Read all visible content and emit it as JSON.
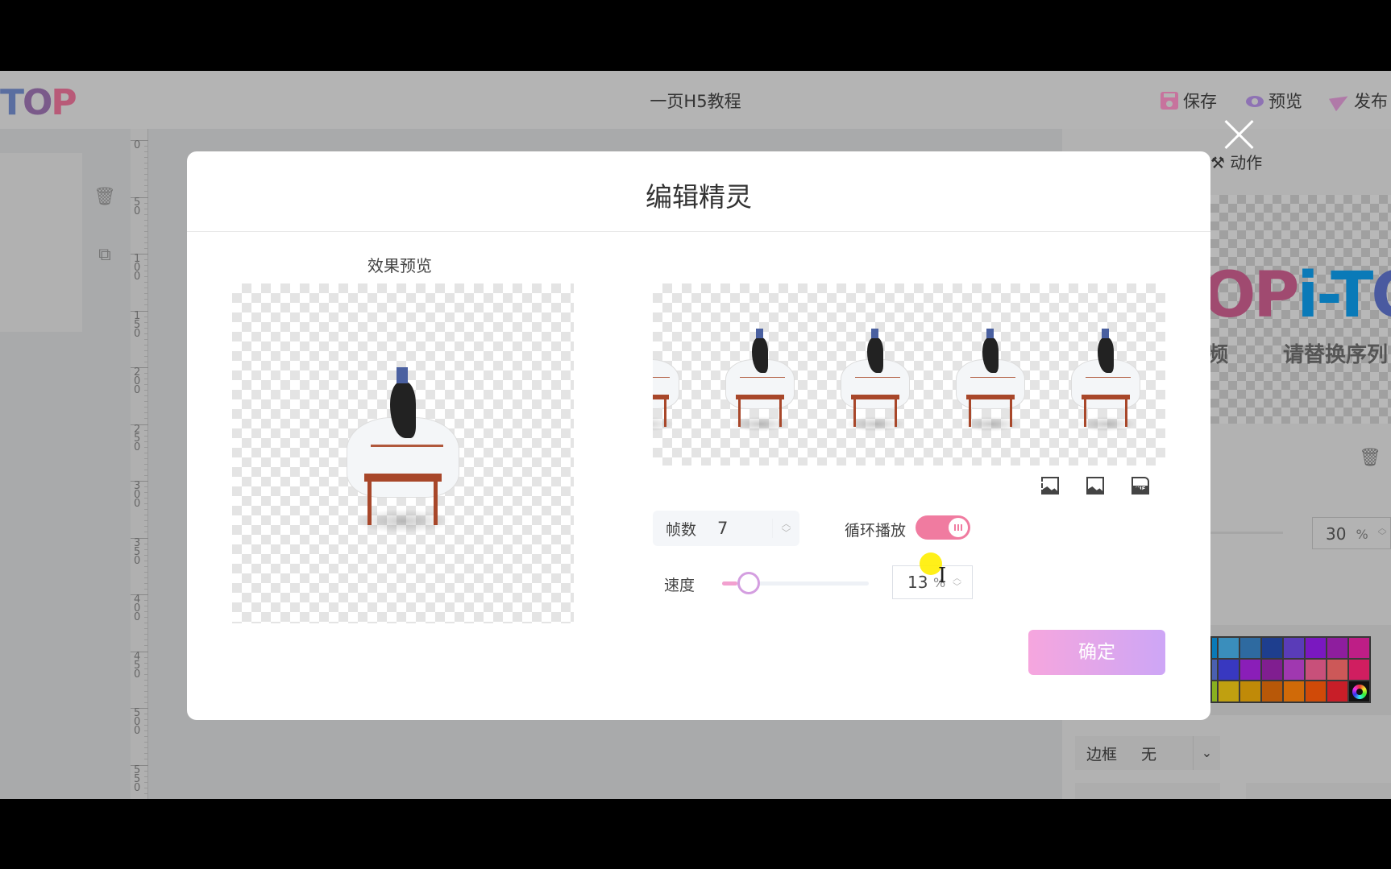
{
  "app": {
    "logo_text": [
      "T",
      "O",
      "P"
    ],
    "title": "一页H5教程",
    "actions": [
      {
        "icon": "save-icon",
        "label": "保存"
      },
      {
        "icon": "eye-icon",
        "label": "预览"
      },
      {
        "icon": "send-icon",
        "label": "发布"
      }
    ]
  },
  "canvas": {
    "left_tools": [
      {
        "icon": "trash-icon",
        "glyph": "🗑"
      },
      {
        "icon": "duplicate-icon",
        "glyph": "⧉"
      }
    ],
    "ruler_ticks": [
      "0",
      "50",
      "100",
      "150",
      "200",
      "250",
      "300",
      "350",
      "400",
      "450",
      "500",
      "550"
    ],
    "timeline": {
      "play_icon": "play-icon"
    }
  },
  "right_panel": {
    "tab_label": "动作",
    "tab_icon_glyph": "⚒",
    "preview_logo": {
      "part1": "OP",
      "part2": "i-T",
      "part3": "O"
    },
    "preview_subtitle_left": "频",
    "preview_subtitle": "请替换序列",
    "trash_glyph": "🗑",
    "opacity": {
      "value": "30",
      "unit": "%"
    },
    "palette": {
      "colors": [
        [
          "#0a7ab8",
          "#3a8ebc",
          "#2e6aa0",
          "#1e3e8e",
          "#5a3cb8",
          "#7a18c0",
          "#8e1e9e",
          "#be1e86"
        ],
        [
          "#4a60b0",
          "#3838c0",
          "#8a1eb8",
          "#801e90",
          "#a038b0",
          "#c8507a",
          "#cc5858",
          "#d01e60"
        ],
        [
          "#88b020",
          "#c0a010",
          "#c08a08",
          "#b85808",
          "#d06a08",
          "#d04a08",
          "#c81e28",
          "wheel"
        ]
      ]
    },
    "border": {
      "label": "边框",
      "value": "无",
      "arrow": "⌄"
    }
  },
  "modal": {
    "title": "编辑精灵",
    "close_icon": "close-icon",
    "preview_label": "效果预览",
    "frame_count": 5,
    "export_icons": [
      "slice-image-icon",
      "image-icon",
      "gif-icon"
    ],
    "gif_label": "GIF",
    "frames": {
      "label": "帧数",
      "value": "7",
      "spin_up": "︿",
      "spin_down": "﹀"
    },
    "loop": {
      "label": "循环播放",
      "enabled": true
    },
    "speed": {
      "label": "速度",
      "value": "13",
      "unit": "%",
      "percent": 13
    },
    "confirm_label": "确定"
  }
}
